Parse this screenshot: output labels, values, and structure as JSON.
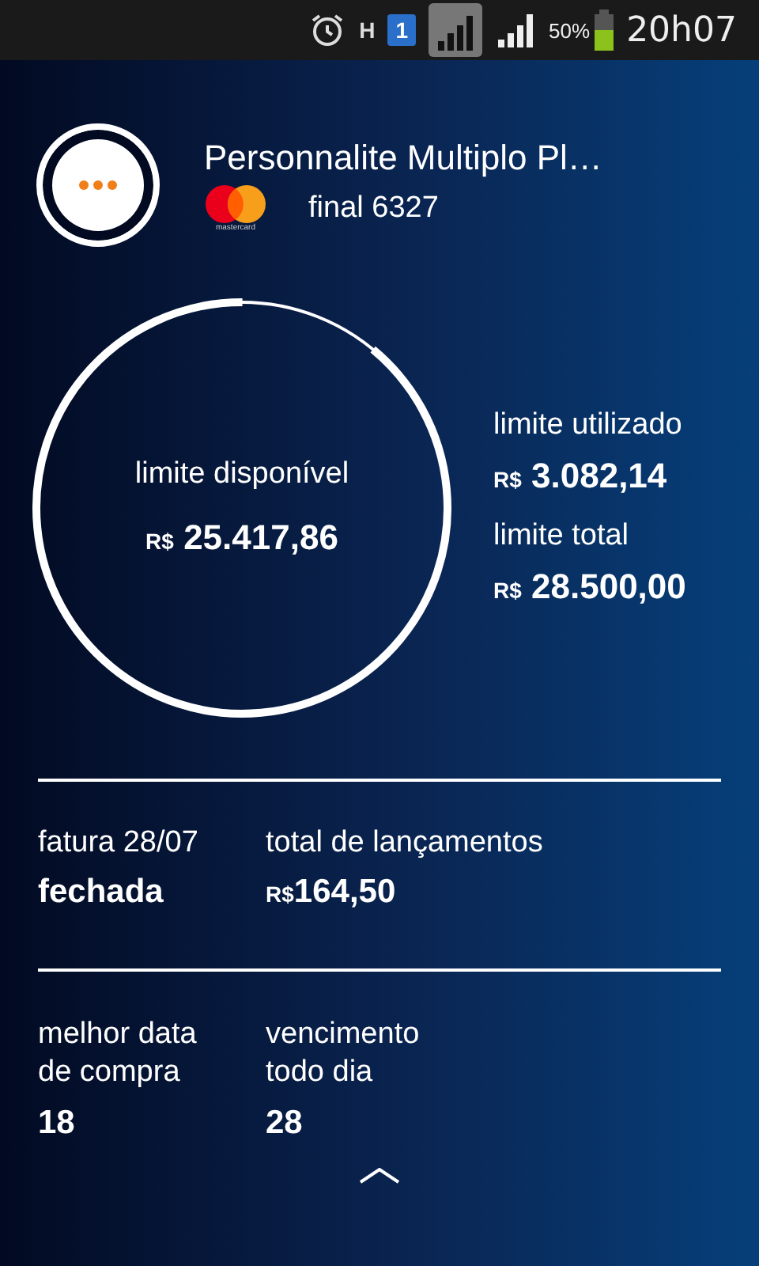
{
  "status_bar": {
    "network": "H",
    "sim": "1",
    "battery": "50%",
    "time": "20h07"
  },
  "card": {
    "name": "Personnalite Multiplo Pl…",
    "brand_text": "mastercard",
    "final": "final 6327"
  },
  "limits": {
    "available": {
      "label": "limite disponível",
      "currency": "R$",
      "amount": "25.417,86"
    },
    "used": {
      "label": "limite utilizado",
      "currency": "R$",
      "amount": "3.082,14"
    },
    "total": {
      "label": "limite total",
      "currency": "R$",
      "amount": "28.500,00"
    }
  },
  "invoice": [
    {
      "label": "fatura 28/07",
      "value": "fechada"
    },
    {
      "label": "total de lançamentos",
      "value": "164,50",
      "currency": "R$"
    }
  ],
  "dates": [
    {
      "label": "melhor data de compra",
      "value": "18"
    },
    {
      "label": "vencimento todo dia",
      "value": "28"
    }
  ]
}
